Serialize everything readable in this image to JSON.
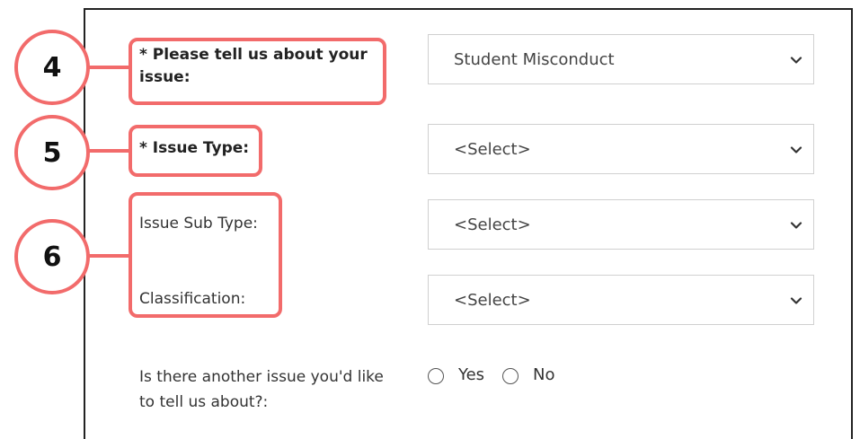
{
  "form": {
    "issue_about": {
      "label": "* Please tell us about your issue:",
      "value": "Student Misconduct"
    },
    "issue_type": {
      "label": "* Issue Type:",
      "value": "<Select>"
    },
    "issue_sub_type": {
      "label": "Issue Sub Type:",
      "value": "<Select>"
    },
    "classification": {
      "label": "Classification:",
      "value": "<Select>"
    },
    "another_issue": {
      "label": "Is there another issue you'd like to tell us about?:",
      "options": [
        "Yes",
        "No"
      ]
    }
  },
  "callouts": [
    "4",
    "5",
    "6"
  ],
  "colors": {
    "callout": "#f26b6b",
    "border": "#d0d0d0"
  },
  "icons": {
    "dropdown": "chevron-down-icon"
  }
}
